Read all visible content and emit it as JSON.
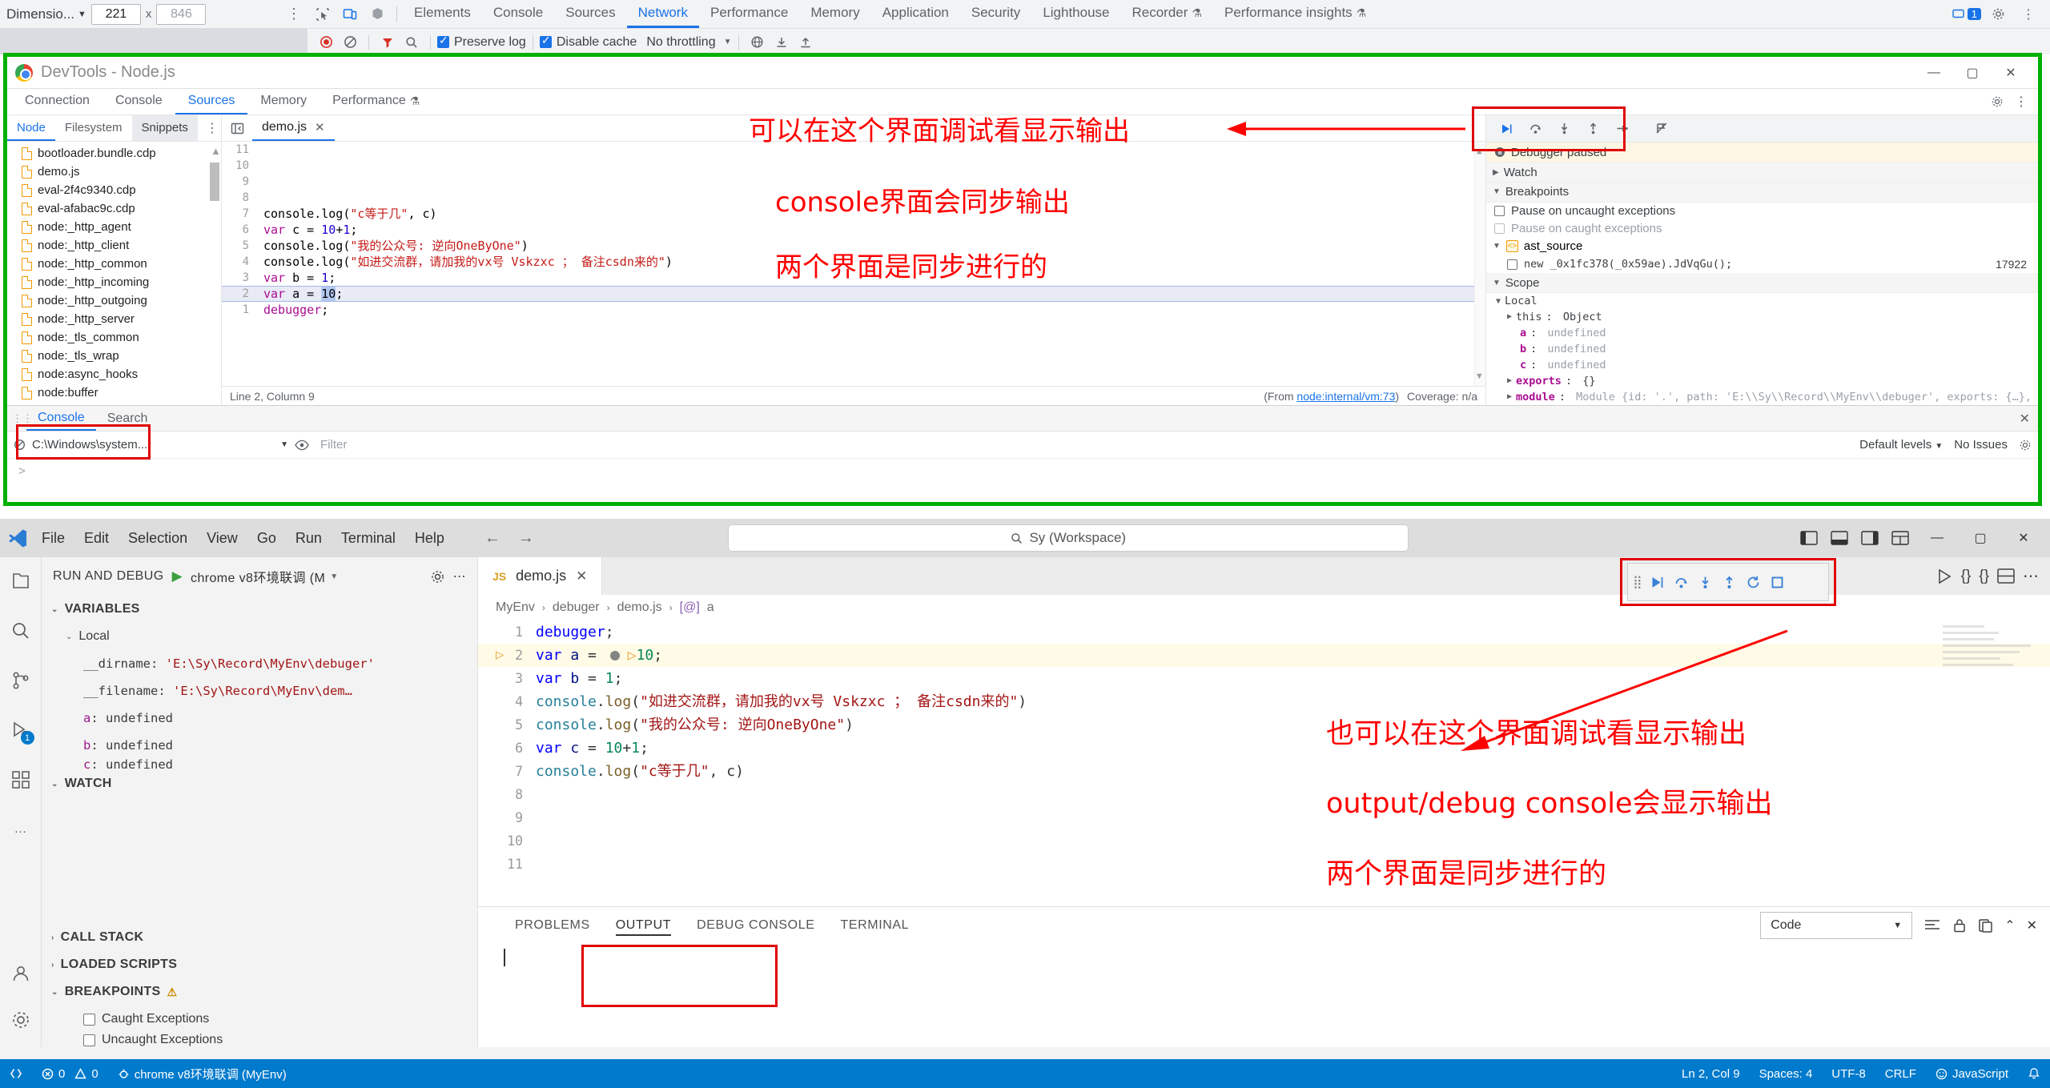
{
  "chrome_devtools_strip": {
    "device_toolbar": {
      "dimension_label": "Dimensio...",
      "width_value": "221",
      "times": "x",
      "height_placeholder": "846",
      "kebab_icon": "more-vertical-icon"
    },
    "tabs": [
      {
        "label": "Elements",
        "selected": false
      },
      {
        "label": "Console",
        "selected": false
      },
      {
        "label": "Sources",
        "selected": false
      },
      {
        "label": "Network",
        "selected": true
      },
      {
        "label": "Performance",
        "selected": false
      },
      {
        "label": "Memory",
        "selected": false
      },
      {
        "label": "Application",
        "selected": false
      },
      {
        "label": "Security",
        "selected": false
      },
      {
        "label": "Lighthouse",
        "selected": false
      },
      {
        "label": "Recorder",
        "selected": false,
        "flask": true
      },
      {
        "label": "Performance insights",
        "selected": false,
        "flask": true
      }
    ],
    "messages_count": "1",
    "network_toolbar": {
      "preserve_log_label": "Preserve log",
      "preserve_log_checked": true,
      "disable_cache_label": "Disable cache",
      "disable_cache_checked": true,
      "throttling_label": "No throttling"
    }
  },
  "node_window": {
    "title": "DevTools - Node.js",
    "window_buttons": [
      "minimize",
      "maximize",
      "close"
    ],
    "tabs": [
      {
        "label": "Connection",
        "selected": false
      },
      {
        "label": "Console",
        "selected": false
      },
      {
        "label": "Sources",
        "selected": true
      },
      {
        "label": "Memory",
        "selected": false
      },
      {
        "label": "Performance",
        "selected": false,
        "flask": true
      }
    ],
    "navigator": {
      "tabs": [
        {
          "label": "Node",
          "selected": true
        },
        {
          "label": "Filesystem",
          "selected": false
        },
        {
          "label": "Snippets",
          "selected": false,
          "active_bg": true
        }
      ],
      "files": [
        "bootloader.bundle.cdp",
        "demo.js",
        "eval-2f4c9340.cdp",
        "eval-afabac9c.cdp",
        "node:_http_agent",
        "node:_http_client",
        "node:_http_common",
        "node:_http_incoming",
        "node:_http_outgoing",
        "node:_http_server",
        "node:_tls_common",
        "node:_tls_wrap",
        "node:async_hooks",
        "node:buffer"
      ]
    },
    "editor": {
      "tab_label": "demo.js",
      "lines": [
        {
          "n": "1",
          "tokens": [
            {
              "t": "debugger",
              "c": "kw2"
            },
            {
              "t": ";",
              "c": ""
            }
          ]
        },
        {
          "n": "2",
          "tokens": [
            {
              "t": "var",
              "c": "kw2"
            },
            {
              "t": " a = ",
              "c": ""
            },
            {
              "t": "10",
              "c": "sel-num"
            },
            {
              "t": ";",
              "c": ""
            }
          ],
          "highlight": true
        },
        {
          "n": "3",
          "tokens": [
            {
              "t": "var",
              "c": "kw2"
            },
            {
              "t": " b = ",
              "c": ""
            },
            {
              "t": "1",
              "c": "num"
            },
            {
              "t": ";",
              "c": ""
            }
          ]
        },
        {
          "n": "4",
          "tokens": [
            {
              "t": "console.log(",
              "c": ""
            },
            {
              "t": "\"如进交流群，请加我的vx号 Vskzxc ； 备注csdn来的\"",
              "c": "str"
            },
            {
              "t": ")",
              "c": ""
            }
          ]
        },
        {
          "n": "5",
          "tokens": [
            {
              "t": "console.log(",
              "c": ""
            },
            {
              "t": "\"我的公众号: 逆向OneByOne\"",
              "c": "str"
            },
            {
              "t": ")",
              "c": ""
            }
          ]
        },
        {
          "n": "6",
          "tokens": [
            {
              "t": "var",
              "c": "kw2"
            },
            {
              "t": " c = ",
              "c": ""
            },
            {
              "t": "10",
              "c": "num"
            },
            {
              "t": "+",
              "c": ""
            },
            {
              "t": "1",
              "c": "num"
            },
            {
              "t": ";",
              "c": ""
            }
          ]
        },
        {
          "n": "7",
          "tokens": [
            {
              "t": "console.log(",
              "c": ""
            },
            {
              "t": "\"c等于几\"",
              "c": "str"
            },
            {
              "t": ", c)",
              "c": ""
            }
          ]
        },
        {
          "n": "8",
          "tokens": []
        },
        {
          "n": "9",
          "tokens": []
        },
        {
          "n": "10",
          "tokens": []
        },
        {
          "n": "11",
          "tokens": []
        }
      ],
      "status_left": "Line 2, Column 9",
      "status_from": "(From node:internal/vm:73)",
      "status_coverage": "Coverage: n/a",
      "status_from_link": "node:internal/vm:73"
    },
    "debugger": {
      "toolbar_buttons": [
        "resume-icon",
        "step-over-icon",
        "step-into-icon",
        "step-out-icon",
        "step-icon",
        "deactivate-breakpoints-icon"
      ],
      "paused_banner": "Debugger paused",
      "watch_label": "Watch",
      "breakpoints_label": "Breakpoints",
      "pause_uncaught_label": "Pause on uncaught exceptions",
      "pause_caught_label": "Pause on caught exceptions",
      "group_label": "ast_source",
      "breakpoint_code": "new _0x1fc378(_0x59ae).JdVqGu();",
      "breakpoint_line": "17922",
      "scope_label": "Scope",
      "local_label": "Local",
      "scope_rows": [
        {
          "name": "this",
          "value": "Object",
          "arrow": true,
          "kind": "obj"
        },
        {
          "name": "a",
          "value": "undefined",
          "arrow": false,
          "kind": "undef"
        },
        {
          "name": "b",
          "value": "undefined",
          "arrow": false,
          "kind": "undef"
        },
        {
          "name": "c",
          "value": "undefined",
          "arrow": false,
          "kind": "undef"
        },
        {
          "name": "exports",
          "value": "{}",
          "arrow": true,
          "kind": "obj"
        },
        {
          "name": "module",
          "value": "Module {id: '.', path: 'E:\\\\Sy\\\\Record\\\\MyEnv\\\\debuger', exports: {…}, filen",
          "arrow": true,
          "kind": "mod"
        }
      ]
    },
    "console": {
      "tabs": [
        {
          "label": "Console",
          "selected": true
        },
        {
          "label": "Search",
          "selected": false
        }
      ],
      "context_value": "C:\\Windows\\system...",
      "filter_placeholder": "Filter",
      "levels_label": "Default levels",
      "issues_label": "No Issues",
      "prompt": ">"
    }
  },
  "annotations": [
    {
      "id": "anno-1",
      "text": "可以在这个界面调试看显示输出"
    },
    {
      "id": "anno-2",
      "text": "console界面会同步输出"
    },
    {
      "id": "anno-3",
      "text": "两个界面是同步进行的"
    },
    {
      "id": "anno-4",
      "text": "也可以在这个界面调试看显示输出"
    },
    {
      "id": "anno-5",
      "text": "output/debug console会显示输出"
    },
    {
      "id": "anno-6",
      "text": "两个界面是同步进行的"
    }
  ],
  "vscode": {
    "menu": [
      "File",
      "Edit",
      "Selection",
      "View",
      "Go",
      "Run",
      "Terminal",
      "Help"
    ],
    "search_placeholder": "Sy (Workspace)",
    "window_buttons": [
      "minimize",
      "maximize",
      "close"
    ],
    "activity_bar": [
      {
        "name": "explorer-icon",
        "badge": ""
      },
      {
        "name": "search-icon",
        "badge": ""
      },
      {
        "name": "source-control-icon",
        "badge": ""
      },
      {
        "name": "run-debug-icon",
        "badge": "1"
      },
      {
        "name": "extensions-icon",
        "badge": ""
      },
      {
        "name": "more-icon",
        "badge": ""
      },
      {
        "name": "account-icon",
        "badge": ""
      },
      {
        "name": "settings-gear-icon",
        "badge": ""
      }
    ],
    "debug_panel": {
      "title": "RUN AND DEBUG",
      "config_name": "chrome v8环境联调 (M",
      "variables_label": "VARIABLES",
      "local_label": "Local",
      "variables": [
        {
          "name": "__dirname",
          "value": "'E:\\Sy\\Record\\MyEnv\\debuger'",
          "string": true
        },
        {
          "name": "__filename",
          "value": "'E:\\Sy\\Record\\MyEnv\\dem…",
          "string": true
        },
        {
          "name": "a",
          "value": "undefined",
          "string": false,
          "bold": true
        },
        {
          "name": "b",
          "value": "undefined",
          "string": false,
          "bold": true
        },
        {
          "name": "c",
          "value": "undefined",
          "string": false,
          "bold": true
        }
      ],
      "watch_label": "WATCH",
      "call_stack_label": "CALL STACK",
      "loaded_scripts_label": "LOADED SCRIPTS",
      "breakpoints_label": "BREAKPOINTS",
      "caught_exceptions_label": "Caught Exceptions",
      "uncaught_exceptions_label": "Uncaught Exceptions"
    },
    "editor": {
      "tab_label": "demo.js",
      "tab_badge": "JS",
      "breadcrumb": [
        "MyEnv",
        "debuger",
        "demo.js",
        "a"
      ],
      "breadcrumb_symbol_badge": "[@]",
      "lines": [
        {
          "n": "1",
          "tokens": [
            {
              "t": "debugger",
              "c": "v-kw"
            },
            {
              "t": ";",
              "c": ""
            }
          ]
        },
        {
          "n": "2",
          "tokens": [
            {
              "t": "var",
              "c": "v-kw"
            },
            {
              "t": " ",
              "c": ""
            },
            {
              "t": "a",
              "c": "v-var"
            },
            {
              "t": " = ",
              "c": ""
            },
            {
              "t": "10",
              "c": "v-num"
            },
            {
              "t": ";",
              "c": ""
            }
          ],
          "current": true,
          "breakpoint": true
        },
        {
          "n": "3",
          "tokens": [
            {
              "t": "var",
              "c": "v-kw"
            },
            {
              "t": " ",
              "c": ""
            },
            {
              "t": "b",
              "c": "v-var"
            },
            {
              "t": " = ",
              "c": ""
            },
            {
              "t": "1",
              "c": "v-num"
            },
            {
              "t": ";",
              "c": ""
            }
          ]
        },
        {
          "n": "4",
          "tokens": [
            {
              "t": "console",
              "c": "v-obj"
            },
            {
              "t": ".",
              "c": ""
            },
            {
              "t": "log",
              "c": "v-fn"
            },
            {
              "t": "(",
              "c": ""
            },
            {
              "t": "\"如进交流群，请加我的vx号 Vskzxc ； 备注csdn来的\"",
              "c": "v-str"
            },
            {
              "t": ")",
              "c": ""
            }
          ]
        },
        {
          "n": "5",
          "tokens": [
            {
              "t": "console",
              "c": "v-obj"
            },
            {
              "t": ".",
              "c": ""
            },
            {
              "t": "log",
              "c": "v-fn"
            },
            {
              "t": "(",
              "c": ""
            },
            {
              "t": "\"我的公众号: 逆向OneByOne\"",
              "c": "v-str"
            },
            {
              "t": ")",
              "c": ""
            }
          ]
        },
        {
          "n": "6",
          "tokens": [
            {
              "t": "var",
              "c": "v-kw"
            },
            {
              "t": " ",
              "c": ""
            },
            {
              "t": "c",
              "c": "v-var"
            },
            {
              "t": " = ",
              "c": ""
            },
            {
              "t": "10",
              "c": "v-num"
            },
            {
              "t": "+",
              "c": ""
            },
            {
              "t": "1",
              "c": "v-num"
            },
            {
              "t": ";",
              "c": ""
            }
          ]
        },
        {
          "n": "7",
          "tokens": [
            {
              "t": "console",
              "c": "v-obj"
            },
            {
              "t": ".",
              "c": ""
            },
            {
              "t": "log",
              "c": "v-fn"
            },
            {
              "t": "(",
              "c": ""
            },
            {
              "t": "\"c等于几\"",
              "c": "v-str"
            },
            {
              "t": ", c)",
              "c": ""
            }
          ]
        },
        {
          "n": "8",
          "tokens": []
        },
        {
          "n": "9",
          "tokens": []
        },
        {
          "n": "10",
          "tokens": []
        },
        {
          "n": "11",
          "tokens": []
        }
      ]
    },
    "debug_toolbar_buttons": [
      "drag-handle-icon",
      "continue-icon",
      "step-over-icon",
      "step-into-icon",
      "step-out-icon",
      "restart-icon",
      "stop-icon"
    ],
    "panel": {
      "tabs": [
        {
          "label": "PROBLEMS",
          "selected": false
        },
        {
          "label": "OUTPUT",
          "selected": true
        },
        {
          "label": "DEBUG CONSOLE",
          "selected": false
        },
        {
          "label": "TERMINAL",
          "selected": false
        }
      ],
      "channel_value": "Code"
    },
    "status_bar": {
      "remote_icon": "remote-icon",
      "errors": "0",
      "warnings": "0",
      "debug_session": "chrome v8环境联调 (MyEnv)",
      "position": "Ln 2, Col 9",
      "spaces": "Spaces: 4",
      "encoding": "UTF-8",
      "eol": "CRLF",
      "language": "JavaScript",
      "bell_icon": "bell-icon"
    }
  }
}
